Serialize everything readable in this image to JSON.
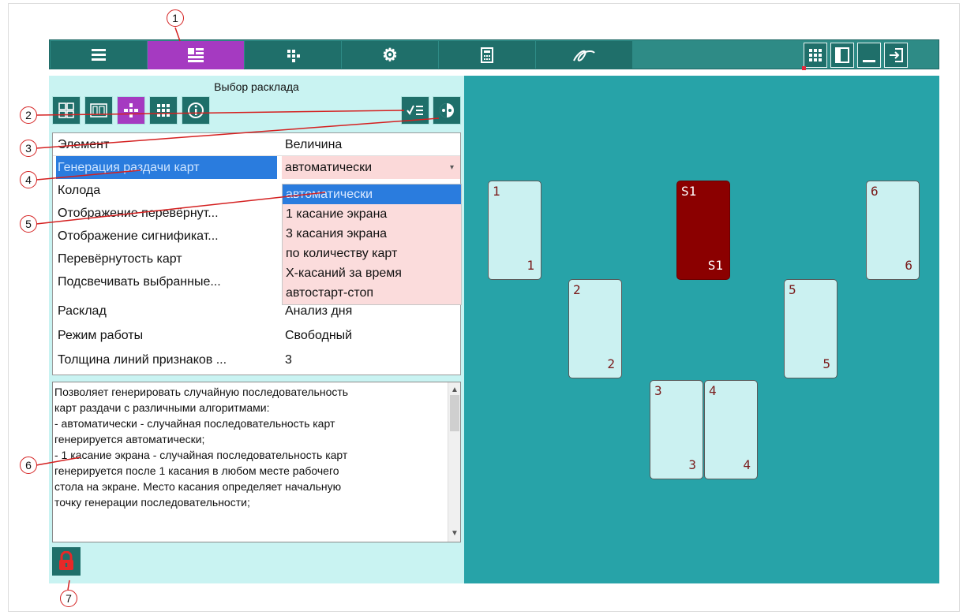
{
  "panel": {
    "title": "Выбор расклада"
  },
  "properties": {
    "header": {
      "element": "Элемент",
      "value": "Величина"
    },
    "rows": [
      {
        "name": "Генерация раздачи карт",
        "value": "автоматически"
      },
      {
        "name": "Колода",
        "value": ""
      },
      {
        "name": "Отображение перевёрнут...",
        "value": ""
      },
      {
        "name": "Отображение сигнификат...",
        "value": ""
      },
      {
        "name": "Перевёрнутость карт",
        "value": ""
      },
      {
        "name": "Подсвечивать выбранные...",
        "value": ""
      },
      {
        "name": "Расклад",
        "value": "Анализ дня"
      },
      {
        "name": "Режим работы",
        "value": "Свободный"
      },
      {
        "name": "Толщина линий признаков ...",
        "value": "3"
      }
    ]
  },
  "dropdown": {
    "options": [
      "автоматически",
      "1 касание экрана",
      "3 касания экрана",
      "по количеству карт",
      "Х-касаний за время",
      "автостарт-стоп"
    ],
    "selected": "автоматически"
  },
  "description": {
    "lines": [
      "Позволяет генерировать случайную последовательность",
      "карт раздачи с различными алгоритмами:",
      "- автоматически - случайная последовательность карт",
      "генерируется автоматически;",
      "- 1 касание экрана - случайная последовательность карт",
      "генерируется после 1 касания в любом месте рабочего",
      "стола на экране. Место касания определяет начальную",
      "точку генерации последовательности;"
    ]
  },
  "cards": [
    {
      "id": "1",
      "top_label": "1",
      "bottom_label": "1",
      "style": "normal"
    },
    {
      "id": "S1",
      "top_label": "S1",
      "bottom_label": "S1",
      "style": "significator"
    },
    {
      "id": "6",
      "top_label": "6",
      "bottom_label": "6",
      "style": "normal"
    },
    {
      "id": "2",
      "top_label": "2",
      "bottom_label": "2",
      "style": "normal"
    },
    {
      "id": "5",
      "top_label": "5",
      "bottom_label": "5",
      "style": "normal"
    },
    {
      "id": "3",
      "top_label": "3",
      "bottom_label": "3",
      "style": "normal"
    },
    {
      "id": "4",
      "top_label": "4",
      "bottom_label": "4",
      "style": "normal"
    }
  ],
  "callouts": [
    "1",
    "2",
    "3",
    "4",
    "5",
    "6",
    "7"
  ],
  "colors": {
    "accent_purple": "#a53ac1",
    "toolbar_teal": "#1f6f6a",
    "board_teal": "#27a3a8",
    "panel_bg": "#c9f3f2",
    "selection_blue": "#2a7cde",
    "dropdown_pink": "#fbdcdc",
    "significator_red": "#8b0000",
    "callout_red": "#d42020"
  },
  "icons": {
    "tabs": [
      "menu-icon",
      "layout-icon",
      "grid-dots-icon",
      "gear-icon",
      "calculator-icon",
      "signature-icon"
    ],
    "right": [
      "grid-view-icon",
      "panel-toggle-icon",
      "minimize-icon",
      "exit-icon"
    ],
    "toolbar": [
      "tiles-icon",
      "card-deck-icon",
      "spread-cross-icon",
      "grid-small-icon",
      "info-icon",
      "checklist-icon",
      "theme-toggle-icon"
    ],
    "lock": "lock-icon"
  }
}
